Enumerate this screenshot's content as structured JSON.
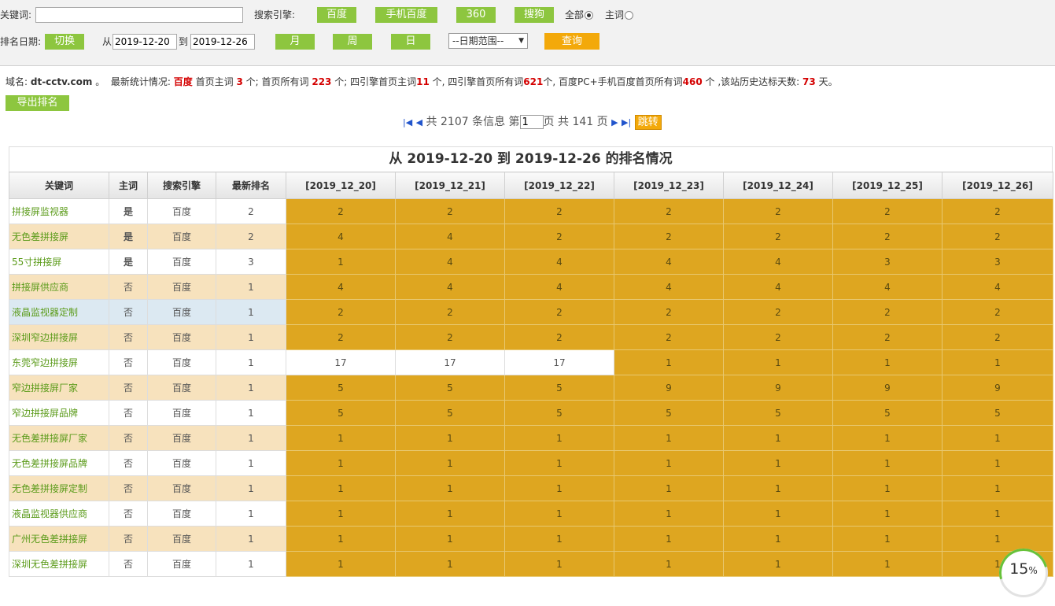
{
  "toolbar": {
    "keyword_label": "关键词:",
    "keyword_value": "",
    "engine_label": "搜索引擎:",
    "engines": [
      "百度",
      "手机百度",
      "360",
      "搜狗"
    ],
    "scope_all": "全部",
    "scope_main": "主词",
    "date_label": "排名日期:",
    "switch_label": "切换",
    "from_label": "从",
    "date_from": "2019-12-20",
    "to_label": "到",
    "date_to": "2019-12-26",
    "month": "月",
    "week": "周",
    "day": "日",
    "range_select": "--日期范围--",
    "query": "查询"
  },
  "stats": {
    "domain_label": "域名:",
    "domain": "dt-cctv.com",
    "sep": "。",
    "latest_label": "最新统计情况:",
    "engine": "百度",
    "t1": "首页主词",
    "v1": "3",
    "t2": "个; 首页所有词",
    "v2": "223",
    "t3": "个; 四引擎首页主词",
    "v3": "11",
    "t4": "个, 四引擎首页所有词",
    "v4": "621",
    "t5": "个, 百度PC+手机百度首页所有词",
    "v5": "460",
    "t6": "个 ,该站历史达标天数:",
    "v6": "73",
    "t7": "天。"
  },
  "export_label": "导出排名",
  "pager": {
    "total_prefix": "共",
    "total": "2107",
    "total_suffix": "条信息 第",
    "page": "1",
    "pages_prefix": "页 共",
    "pages": "141",
    "pages_suffix": "页",
    "jump": "跳转"
  },
  "table": {
    "title": "从 2019-12-20 到 2019-12-26 的排名情况",
    "headers": [
      "关键词",
      "主词",
      "搜索引擎",
      "最新排名",
      "[2019_12_20]",
      "[2019_12_21]",
      "[2019_12_22]",
      "[2019_12_23]",
      "[2019_12_24]",
      "[2019_12_25]",
      "[2019_12_26]"
    ],
    "rows": [
      {
        "kw": "拼接屏监视器",
        "main": "是",
        "engine": "百度",
        "latest": "2",
        "ranks": [
          "2",
          "2",
          "2",
          "2",
          "2",
          "2",
          "2"
        ]
      },
      {
        "kw": "无色差拼接屏",
        "main": "是",
        "engine": "百度",
        "latest": "2",
        "ranks": [
          "4",
          "4",
          "2",
          "2",
          "2",
          "2",
          "2"
        ]
      },
      {
        "kw": "55寸拼接屏",
        "main": "是",
        "engine": "百度",
        "latest": "3",
        "ranks": [
          "1",
          "4",
          "4",
          "4",
          "4",
          "3",
          "3"
        ]
      },
      {
        "kw": "拼接屏供应商",
        "main": "否",
        "engine": "百度",
        "latest": "1",
        "ranks": [
          "4",
          "4",
          "4",
          "4",
          "4",
          "4",
          "4"
        ]
      },
      {
        "kw": "液晶监视器定制",
        "main": "否",
        "engine": "百度",
        "latest": "1",
        "ranks": [
          "2",
          "2",
          "2",
          "2",
          "2",
          "2",
          "2"
        ]
      },
      {
        "kw": "深圳窄边拼接屏",
        "main": "否",
        "engine": "百度",
        "latest": "1",
        "ranks": [
          "2",
          "2",
          "2",
          "2",
          "2",
          "2",
          "2"
        ]
      },
      {
        "kw": "东莞窄边拼接屏",
        "main": "否",
        "engine": "百度",
        "latest": "1",
        "ranks": [
          "17",
          "17",
          "17",
          "1",
          "1",
          "1",
          "1"
        ]
      },
      {
        "kw": "窄边拼接屏厂家",
        "main": "否",
        "engine": "百度",
        "latest": "1",
        "ranks": [
          "5",
          "5",
          "5",
          "9",
          "9",
          "9",
          "9"
        ]
      },
      {
        "kw": "窄边拼接屏品牌",
        "main": "否",
        "engine": "百度",
        "latest": "1",
        "ranks": [
          "5",
          "5",
          "5",
          "5",
          "5",
          "5",
          "5"
        ]
      },
      {
        "kw": "无色差拼接屏厂家",
        "main": "否",
        "engine": "百度",
        "latest": "1",
        "ranks": [
          "1",
          "1",
          "1",
          "1",
          "1",
          "1",
          "1"
        ]
      },
      {
        "kw": "无色差拼接屏品牌",
        "main": "否",
        "engine": "百度",
        "latest": "1",
        "ranks": [
          "1",
          "1",
          "1",
          "1",
          "1",
          "1",
          "1"
        ]
      },
      {
        "kw": "无色差拼接屏定制",
        "main": "否",
        "engine": "百度",
        "latest": "1",
        "ranks": [
          "1",
          "1",
          "1",
          "1",
          "1",
          "1",
          "1"
        ]
      },
      {
        "kw": "液晶监视器供应商",
        "main": "否",
        "engine": "百度",
        "latest": "1",
        "ranks": [
          "1",
          "1",
          "1",
          "1",
          "1",
          "1",
          "1"
        ]
      },
      {
        "kw": "广州无色差拼接屏",
        "main": "否",
        "engine": "百度",
        "latest": "1",
        "ranks": [
          "1",
          "1",
          "1",
          "1",
          "1",
          "1",
          "1"
        ]
      },
      {
        "kw": "深圳无色差拼接屏",
        "main": "否",
        "engine": "百度",
        "latest": "1",
        "ranks": [
          "1",
          "1",
          "1",
          "1",
          "1",
          "1",
          "1"
        ]
      }
    ]
  },
  "progress": {
    "value": "15",
    "unit": "%"
  },
  "colors": {
    "green_button": "#8dc63f",
    "orange_button": "#f3a90a",
    "rank_gold": "#dea620",
    "stripe": "#f7e2bd",
    "main_yes": "#e00000"
  }
}
